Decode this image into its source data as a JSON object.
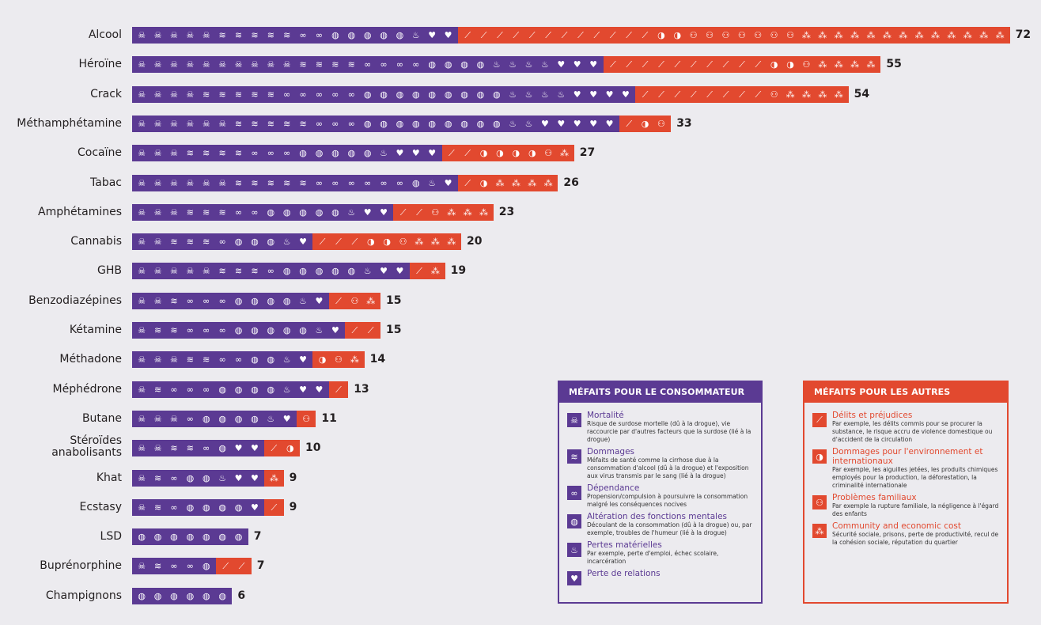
{
  "colors": {
    "user": "#5b3a93",
    "others": "#e2492f",
    "background": "#ecebef"
  },
  "icons": {
    "mortality": "☠",
    "damage": "≋",
    "dependence": "∞",
    "mental": "◍",
    "loss_tangibles": "♨",
    "loss_relationships": "♥",
    "crime": "⟋",
    "environment": "◑",
    "family": "⚇",
    "community": "⁂"
  },
  "chart_data": {
    "type": "bar",
    "orientation": "horizontal",
    "stacked": true,
    "title": "",
    "xlabel": "",
    "ylabel": "",
    "categories": [
      "Alcool",
      "Héroïne",
      "Crack",
      "Méthamphétamine",
      "Cocaïne",
      "Tabac",
      "Amphétamines",
      "Cannabis",
      "GHB",
      "Benzodiazépines",
      "Kétamine",
      "Méthadone",
      "Méphédrone",
      "Butane",
      "Stéroïdes\nanabolisants",
      "Khat",
      "Ecstasy",
      "LSD",
      "Buprénorphine",
      "Champignons"
    ],
    "scores": [
      72,
      55,
      54,
      33,
      27,
      26,
      23,
      20,
      19,
      15,
      15,
      14,
      13,
      11,
      10,
      9,
      9,
      7,
      7,
      6
    ],
    "icon_order_user": [
      "mortality",
      "damage",
      "dependence",
      "mental",
      "loss_tangibles",
      "loss_relationships"
    ],
    "icon_order_others": [
      "crime",
      "environment",
      "family",
      "community"
    ],
    "rows": [
      {
        "user": [
          5,
          5,
          2,
          5,
          1,
          2
        ],
        "others": [
          12,
          2,
          7,
          13
        ]
      },
      {
        "user": [
          10,
          4,
          4,
          4,
          4,
          3
        ],
        "others": [
          10,
          2,
          1,
          4
        ]
      },
      {
        "user": [
          4,
          5,
          5,
          9,
          4,
          4
        ],
        "others": [
          8,
          0,
          1,
          4
        ]
      },
      {
        "user": [
          6,
          5,
          3,
          9,
          2,
          5
        ],
        "others": [
          1,
          1,
          1,
          0
        ]
      },
      {
        "user": [
          3,
          4,
          3,
          5,
          1,
          3
        ],
        "others": [
          2,
          4,
          1,
          1
        ]
      },
      {
        "user": [
          6,
          5,
          6,
          1,
          1,
          1
        ],
        "others": [
          1,
          1,
          0,
          4
        ]
      },
      {
        "user": [
          3,
          3,
          2,
          5,
          1,
          2
        ],
        "others": [
          2,
          0,
          1,
          3
        ]
      },
      {
        "user": [
          2,
          3,
          1,
          3,
          1,
          1
        ],
        "others": [
          3,
          2,
          1,
          3
        ]
      },
      {
        "user": [
          5,
          3,
          1,
          5,
          1,
          2
        ],
        "others": [
          1,
          0,
          0,
          1
        ]
      },
      {
        "user": [
          2,
          1,
          3,
          4,
          1,
          1
        ],
        "others": [
          1,
          0,
          1,
          1
        ]
      },
      {
        "user": [
          1,
          2,
          3,
          5,
          1,
          1
        ],
        "others": [
          2,
          0,
          0,
          0
        ]
      },
      {
        "user": [
          3,
          2,
          2,
          2,
          1,
          1
        ],
        "others": [
          0,
          1,
          1,
          1
        ]
      },
      {
        "user": [
          1,
          1,
          3,
          4,
          1,
          2
        ],
        "others": [
          1,
          0,
          0,
          0
        ]
      },
      {
        "user": [
          3,
          0,
          1,
          4,
          1,
          1
        ],
        "others": [
          0,
          0,
          1,
          0
        ]
      },
      {
        "user": [
          2,
          2,
          1,
          1,
          0,
          2
        ],
        "others": [
          1,
          1,
          0,
          0
        ]
      },
      {
        "user": [
          1,
          1,
          1,
          2,
          1,
          2
        ],
        "others": [
          0,
          0,
          0,
          1
        ]
      },
      {
        "user": [
          1,
          1,
          1,
          4,
          0,
          1
        ],
        "others": [
          1,
          0,
          0,
          0
        ]
      },
      {
        "user": [
          0,
          0,
          0,
          7,
          0,
          0
        ],
        "others": [
          0,
          0,
          0,
          0
        ]
      },
      {
        "user": [
          1,
          1,
          2,
          1,
          0,
          0
        ],
        "others": [
          2,
          0,
          0,
          0
        ]
      },
      {
        "user": [
          0,
          0,
          0,
          6,
          0,
          0
        ],
        "others": [
          0,
          0,
          0,
          0
        ]
      }
    ],
    "series": [
      {
        "name": "Méfaits pour le consommateur",
        "color": "#5b3a93"
      },
      {
        "name": "Méfaits pour les autres",
        "color": "#e2492f"
      }
    ],
    "legend_placement": "bottom-right"
  },
  "legend_user": {
    "title": "MÉFAITS POUR LE CONSOMMATEUR",
    "items": [
      {
        "key": "mortality",
        "title": "Mortalité",
        "desc": "Risque de surdose mortelle (dû à la drogue), vie raccourcie par d'autres facteurs que la surdose (lié à la drogue)"
      },
      {
        "key": "damage",
        "title": "Dommages",
        "desc": "Méfaits de santé comme la cirrhose due à la consommation d'alcool (dû à la drogue) et l'exposition aux virus transmis par le sang (lié à la drogue)"
      },
      {
        "key": "dependence",
        "title": "Dépendance",
        "desc": "Propension/compulsion à poursuivre la consommation malgré les conséquences nocives"
      },
      {
        "key": "mental",
        "title": "Altération des fonctions mentales",
        "desc": "Découlant de la consommation (dû à la drogue) ou, par exemple, troubles de l'humeur (lié à la drogue)"
      },
      {
        "key": "loss_tangibles",
        "title": "Pertes matérielles",
        "desc": "Par exemple, perte d'emploi, échec scolaire, incarcération"
      },
      {
        "key": "loss_relationships",
        "title": "Perte de relations",
        "desc": ""
      }
    ]
  },
  "legend_others": {
    "title": "MÉFAITS POUR LES AUTRES",
    "items": [
      {
        "key": "crime",
        "title": "Délits et préjudices",
        "desc": "Par exemple, les délits commis pour se procurer la substance, le risque accru de violence domestique ou d'accident de la circulation"
      },
      {
        "key": "environment",
        "title": "Dommages pour l'environnement et internationaux",
        "desc": "Par exemple, les aiguilles jetées, les produits chimiques employés pour la production, la déforestation, la criminalité internationale"
      },
      {
        "key": "family",
        "title": "Problèmes familiaux",
        "desc": "Par exemple la rupture familiale, la négligence à l'égard des enfants"
      },
      {
        "key": "community",
        "title": "Community and economic cost",
        "desc": "Sécurité sociale, prisons, perte de productivité, recul de la cohésion sociale, réputation du quartier"
      }
    ]
  }
}
